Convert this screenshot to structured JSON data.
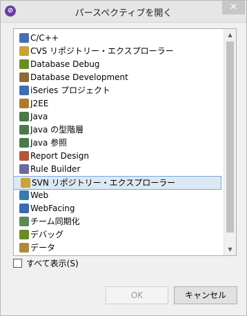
{
  "window": {
    "title": "パースペクティブを開く",
    "close": "✕"
  },
  "perspectives": [
    {
      "label": "C/C++",
      "icon": "c-cpp-icon",
      "color": "#4a6fb0"
    },
    {
      "label": "CVS リポジトリー・エクスプローラー",
      "icon": "cvs-repository-icon",
      "color": "#c9a23a"
    },
    {
      "label": "Database Debug",
      "icon": "database-debug-icon",
      "color": "#6b8e23"
    },
    {
      "label": "Database Development",
      "icon": "database-development-icon",
      "color": "#8b6a3a"
    },
    {
      "label": "iSeries プロジェクト",
      "icon": "iseries-project-icon",
      "color": "#3d6fb0"
    },
    {
      "label": "J2EE",
      "icon": "j2ee-icon",
      "color": "#b07a2a"
    },
    {
      "label": "Java",
      "icon": "java-icon",
      "color": "#4a7a4a"
    },
    {
      "label": "Java の型階層",
      "icon": "java-type-hierarchy-icon",
      "color": "#4a7a4a"
    },
    {
      "label": "Java 参照",
      "icon": "java-browsing-icon",
      "color": "#4a7a4a"
    },
    {
      "label": "Report Design",
      "icon": "report-design-icon",
      "color": "#b05a3a"
    },
    {
      "label": "Rule Builder",
      "icon": "rule-builder-icon",
      "color": "#6a6a9a"
    },
    {
      "label": "SVN リポジトリー・エクスプローラー",
      "icon": "svn-repository-icon",
      "color": "#c9a23a",
      "selected": true
    },
    {
      "label": "Web",
      "icon": "web-icon",
      "color": "#3a7ab0"
    },
    {
      "label": "WebFacing",
      "icon": "webfacing-icon",
      "color": "#3a6ab0"
    },
    {
      "label": "チーム同期化",
      "icon": "team-sync-icon",
      "color": "#5a8a5a"
    },
    {
      "label": "デバッグ",
      "icon": "debug-icon",
      "color": "#6a8a2a"
    },
    {
      "label": "データ",
      "icon": "data-icon",
      "color": "#b08a3a"
    }
  ],
  "show_all": {
    "label": "すべて表示(S)",
    "checked": false
  },
  "buttons": {
    "ok": "OK",
    "cancel": "キャンセル"
  }
}
